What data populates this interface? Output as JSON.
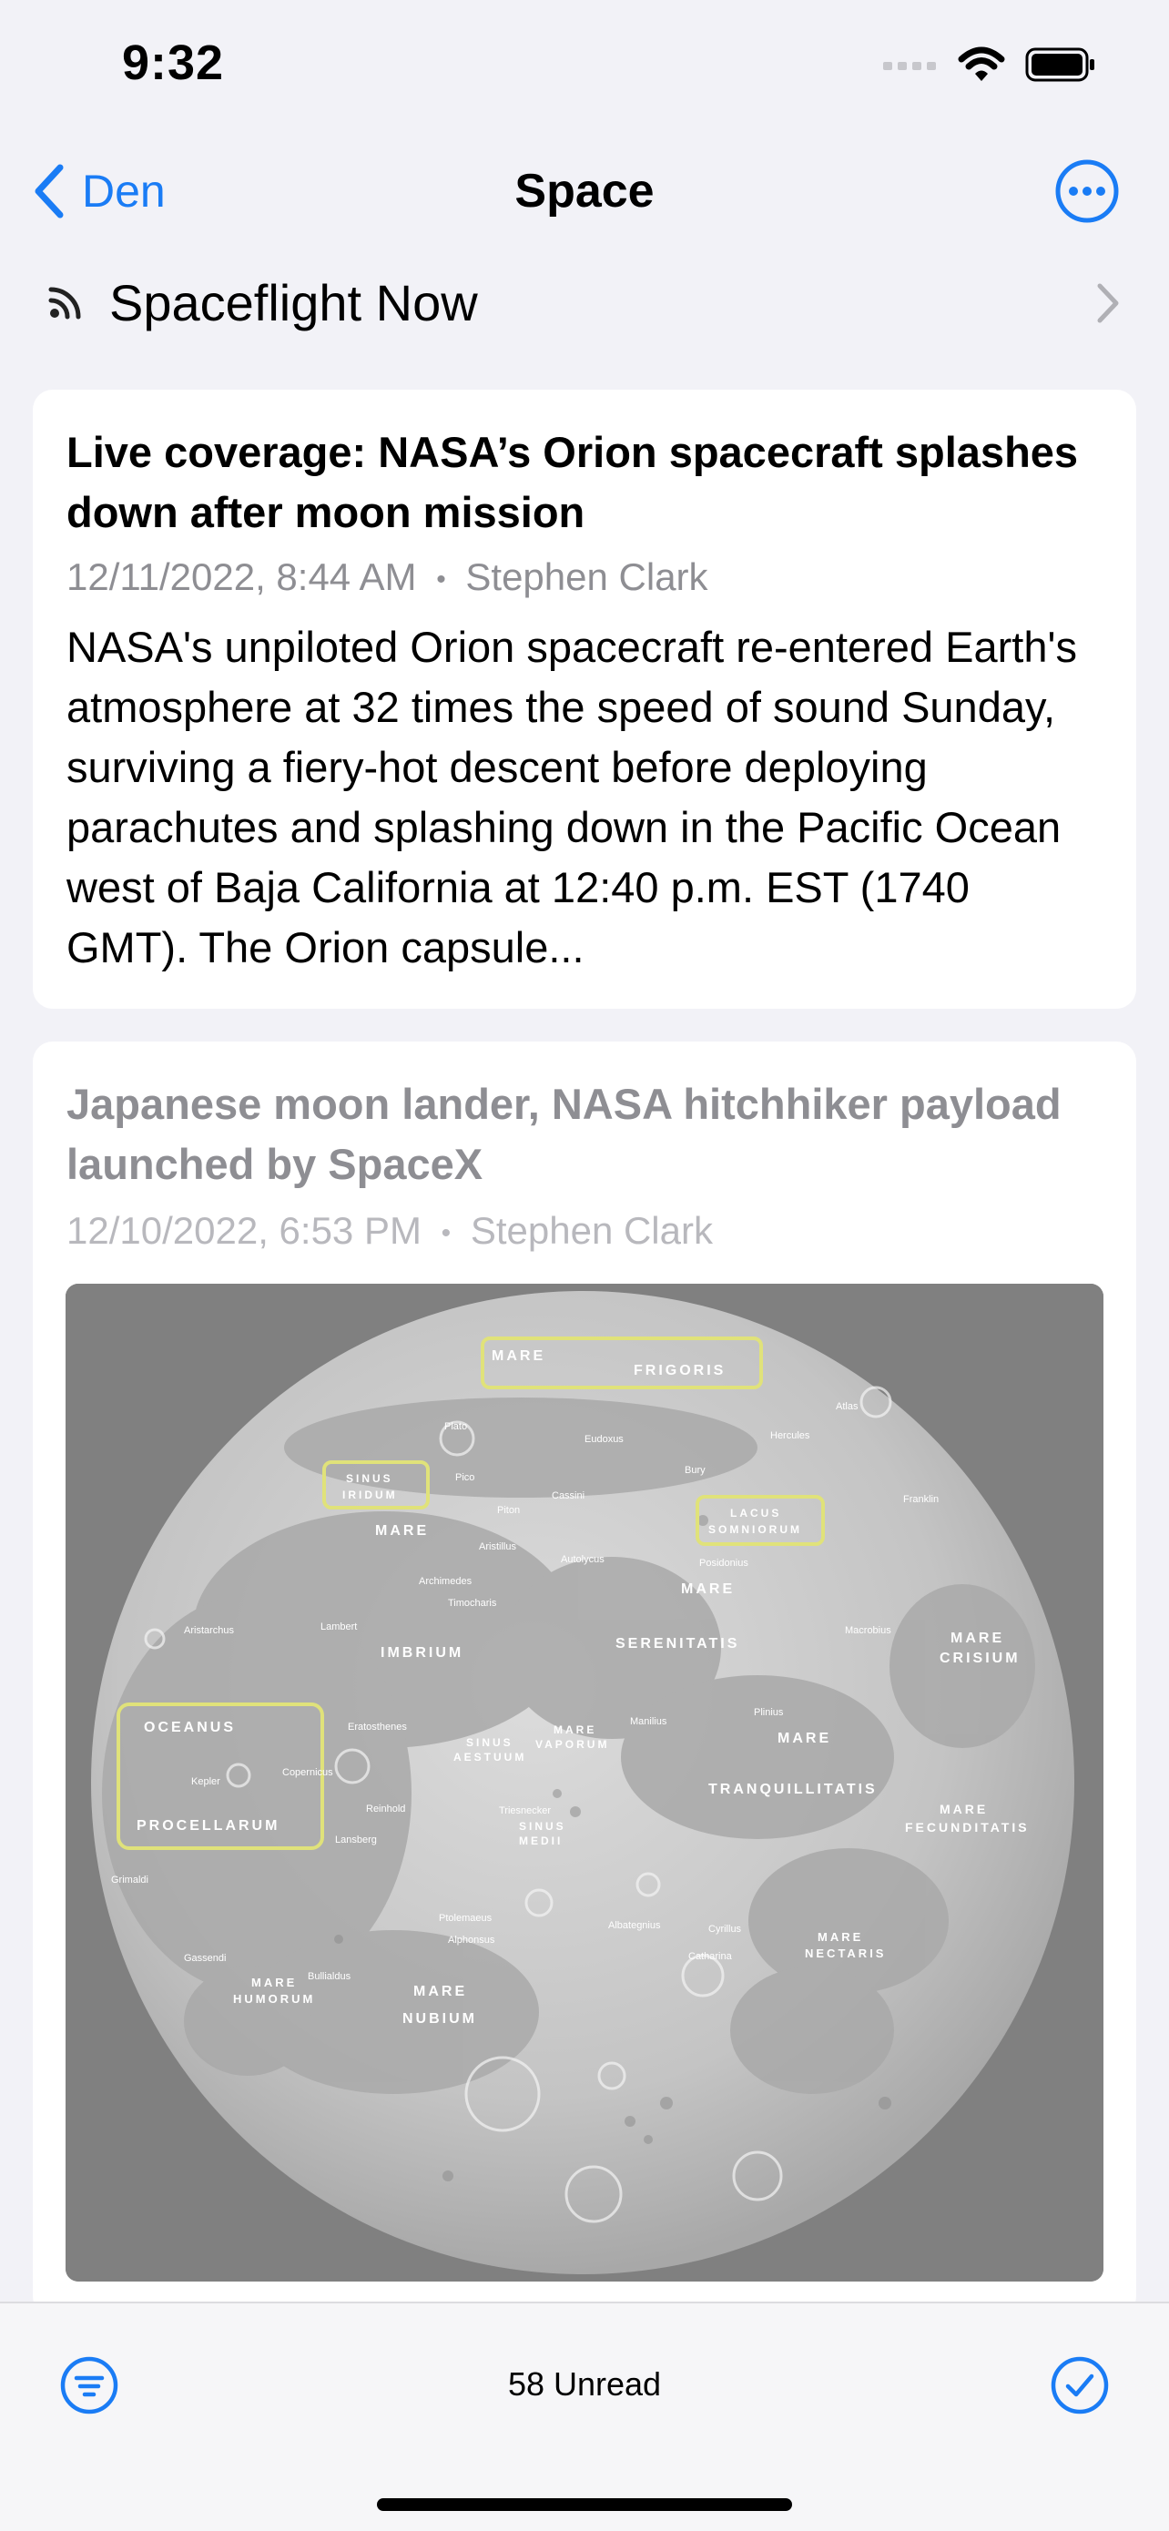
{
  "status_bar": {
    "time": "9:32"
  },
  "nav": {
    "back_label": "Den",
    "title": "Space"
  },
  "feed": {
    "name": "Spaceflight Now"
  },
  "articles": [
    {
      "title": "Live coverage: NASA’s Orion spacecraft splashes down after moon mission",
      "date": "12/11/2022, 8:44 AM",
      "author": "Stephen Clark",
      "separator": "•",
      "summary": "NASA's unpiloted Orion spacecraft re-entered Earth's atmosphere at 32 times the speed of sound Sunday, surviving a fiery-hot descent before deploying parachutes and splashing down in the Pacific Ocean west of Baja California at 12:40 p.m. EST (1740 GMT). The Orion capsule..."
    },
    {
      "title": "Japanese moon lander, NASA hitchhiker payload launched by SpaceX",
      "date": "12/10/2022, 6:53 PM",
      "author": "Stephen Clark",
      "separator": "•",
      "image_labels": {
        "frigoris_1": "MARE",
        "frigoris_2": "FRIGORIS",
        "iridum_1": "SINUS",
        "iridum_2": "IRIDUM",
        "somniorum_1": "LACUS",
        "somniorum_2": "SOMNIORUM",
        "oceanus": "OCEANUS",
        "procellarum": "PROCELLARUM",
        "imbrium_1": "MARE",
        "imbrium_2": "IMBRIUM",
        "serenitatis_1": "MARE",
        "serenitatis_2": "SERENITATIS",
        "tranquillitatis_1": "MARE",
        "tranquillitatis_2": "TRANQUILLITATIS",
        "crisium_1": "MARE",
        "crisium_2": "CRISIUM",
        "fecunditatis_1": "MARE",
        "fecunditatis_2": "FECUNDITATIS",
        "nubium_1": "MARE",
        "nubium_2": "NUBIUM",
        "humorum_1": "MARE",
        "humorum_2": "HUMORUM",
        "nectaris_1": "MARE",
        "nectaris_2": "NECTARIS",
        "vaporum_1": "MARE",
        "vaporum_2": "VAPORUM",
        "aestuum_1": "SINUS",
        "aestuum_2": "AESTUUM",
        "medii_1": "SINUS",
        "medii_2": "MEDII",
        "aristarchus": "Aristarchus",
        "kepler": "Kepler",
        "copernicus": "Copernicus",
        "grimaldi": "Grimaldi",
        "archimedes": "Archimedes",
        "plato": "Plato",
        "eratosthenes": "Eratosthenes",
        "lambert": "Lambert",
        "plinius": "Plinius",
        "posidonius": "Posidonius",
        "macrobius": "Macrobius",
        "alphonsus": "Alphonsus",
        "ptolemaeus": "Ptolemaeus",
        "gassendi": "Gassendi",
        "reinhold": "Reinhold",
        "lansberg": "Lansberg",
        "franklin": "Franklin",
        "atlas": "Atlas",
        "hercules": "Hercules",
        "eudoxus": "Eudoxus",
        "autolycus": "Autolycus",
        "aristillus": "Aristillus",
        "timocharis": "Timocharis",
        "manilius": "Manilius",
        "triesnecker": "Triesnecker",
        "albategnius": "Albategnius",
        "catharina": "Catharina",
        "cyrillus": "Cyrillus",
        "bullialdus": "Bullialdus",
        "pico": "Pico",
        "piton": "Piton",
        "cassini": "Cassini",
        "bury": "Bury"
      }
    }
  ],
  "toolbar": {
    "unread": "58 Unread"
  },
  "colors": {
    "accent": "#1a7cf5",
    "background": "#f2f2f7",
    "card": "#ffffff",
    "secondary_text": "#8e8e93",
    "annotation_box": "#e0e27a"
  },
  "icons": [
    "wifi-icon",
    "battery-icon",
    "chevron-left-icon",
    "ellipsis-circle-icon",
    "rss-icon",
    "chevron-right-icon",
    "filter-icon",
    "checkmark-circle-icon"
  ]
}
